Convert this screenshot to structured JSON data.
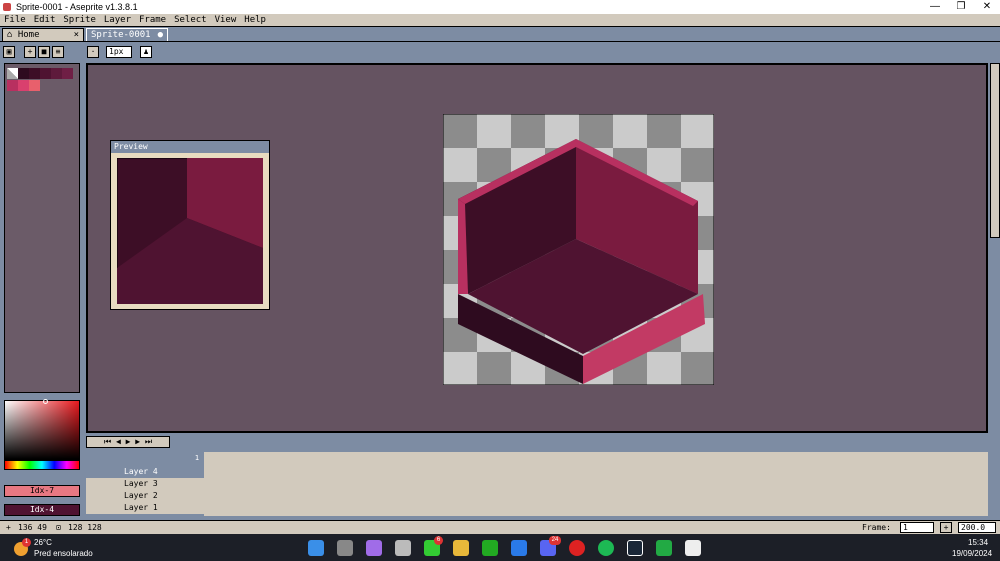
{
  "window": {
    "title": "Sprite-0001 - Aseprite v1.3.8.1",
    "minimize_glyph": "—",
    "maximize_glyph": "❐",
    "close_glyph": "✕"
  },
  "menu": {
    "items": [
      "File",
      "Edit",
      "Sprite",
      "Layer",
      "Frame",
      "Select",
      "View",
      "Help"
    ]
  },
  "tabs": [
    {
      "label": "Home",
      "close_glyph": "×"
    },
    {
      "label": "Sprite-0001",
      "modified_glyph": "●"
    }
  ],
  "toolbar": {
    "brush_size": "1px"
  },
  "palette": {
    "colors": [
      "#2e0b1f",
      "#3d0e26",
      "#4f1331",
      "#5e1a3b",
      "#6f1f45",
      "#b83060",
      "#d9406e",
      "#e8606c"
    ]
  },
  "color_bar": {
    "fg_label": "Idx-7",
    "bg_label": "Idx-4",
    "fg_color": "#e87882",
    "bg_color": "#4f1331"
  },
  "preview": {
    "title": "Preview"
  },
  "timeline": {
    "frame_number": "1",
    "layers": [
      {
        "name": "Layer 4",
        "selected": true
      },
      {
        "name": "Layer 3",
        "selected": false
      },
      {
        "name": "Layer 2",
        "selected": false
      },
      {
        "name": "Layer 1",
        "selected": false
      }
    ]
  },
  "status": {
    "cursor_pos": "136 49",
    "sprite_size": "128 128",
    "frame_label": "Frame:",
    "frame_value": "1",
    "zoom": "200.0"
  },
  "taskbar": {
    "weather_temp": "26°C",
    "weather_desc": "Pred ensolarado",
    "time": "15:34",
    "date": "19/09/2024",
    "weather_badge": "1",
    "whatsapp_badge": "6",
    "discord_badge": "24"
  }
}
